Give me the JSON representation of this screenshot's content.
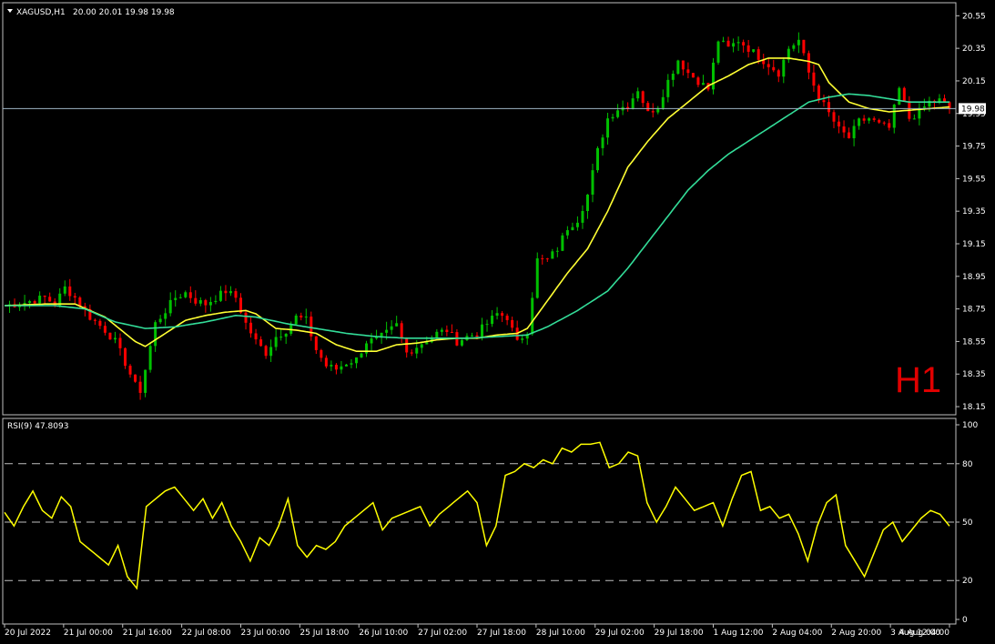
{
  "header": {
    "symbol_label": "XAGUSD,H1",
    "ohlc_label": "20.00 20.01 19.98 19.98"
  },
  "timeframe_label": "H1",
  "rsi_header": {
    "label": "RSI(9) 47.8093"
  },
  "current_price_label": "19.98",
  "colors": {
    "background": "#000000",
    "bull_candle": "#00c000",
    "bear_candle": "#ff0000",
    "ma_fast": "#ffff33",
    "ma_slow": "#33dd99",
    "rsi_line": "#ffff00",
    "grid_text": "#ffffff",
    "timeframe": "#e00000"
  },
  "chart_data": [
    {
      "type": "candlestick",
      "title": "XAGUSD,H1",
      "ylim": [
        18.1,
        20.63
      ],
      "y_ticks": [
        "20.55",
        "20.35",
        "20.15",
        "19.95",
        "19.75",
        "19.55",
        "19.35",
        "19.15",
        "18.95",
        "18.75",
        "18.55",
        "18.35",
        "18.15"
      ],
      "y_tick_values": [
        20.55,
        20.35,
        20.15,
        19.95,
        19.75,
        19.55,
        19.35,
        19.15,
        18.95,
        18.75,
        18.55,
        18.35,
        18.15
      ],
      "x_ticks": [
        "20 Jul 2022",
        "21 Jul 00:00",
        "21 Jul 16:00",
        "22 Jul 08:00",
        "23 Jul 00:00",
        "25 Jul 18:00",
        "26 Jul 10:00",
        "27 Jul 02:00",
        "27 Jul 18:00",
        "28 Jul 10:00",
        "29 Jul 02:00",
        "29 Jul 18:00",
        "1 Aug 12:00",
        "2 Aug 04:00",
        "2 Aug 20:00",
        "3 Aug 12:00",
        "4 Aug 04:00"
      ],
      "current_price": 19.98,
      "close_path": [
        [
          0,
          18.77
        ],
        [
          4,
          18.79
        ],
        [
          8,
          18.82
        ],
        [
          10,
          18.78
        ],
        [
          12,
          18.88
        ],
        [
          14,
          18.82
        ],
        [
          17,
          18.7
        ],
        [
          20,
          18.62
        ],
        [
          22,
          18.55
        ],
        [
          24,
          18.42
        ],
        [
          26,
          18.28
        ],
        [
          27,
          18.25
        ],
        [
          28,
          18.38
        ],
        [
          30,
          18.66
        ],
        [
          32,
          18.74
        ],
        [
          34,
          18.82
        ],
        [
          36,
          18.85
        ],
        [
          38,
          18.8
        ],
        [
          40,
          18.78
        ],
        [
          42,
          18.82
        ],
        [
          44,
          18.86
        ],
        [
          46,
          18.82
        ],
        [
          48,
          18.66
        ],
        [
          50,
          18.55
        ],
        [
          52,
          18.48
        ],
        [
          54,
          18.58
        ],
        [
          56,
          18.62
        ],
        [
          58,
          18.7
        ],
        [
          60,
          18.68
        ],
        [
          62,
          18.5
        ],
        [
          64,
          18.4
        ],
        [
          66,
          18.38
        ],
        [
          68,
          18.42
        ],
        [
          70,
          18.44
        ],
        [
          72,
          18.55
        ],
        [
          74,
          18.56
        ],
        [
          76,
          18.6
        ],
        [
          78,
          18.65
        ],
        [
          80,
          18.48
        ],
        [
          82,
          18.52
        ],
        [
          84,
          18.56
        ],
        [
          86,
          18.6
        ],
        [
          88,
          18.62
        ],
        [
          90,
          18.55
        ],
        [
          92,
          18.58
        ],
        [
          94,
          18.6
        ],
        [
          96,
          18.66
        ],
        [
          98,
          18.72
        ],
        [
          100,
          18.7
        ],
        [
          102,
          18.54
        ],
        [
          104,
          18.62
        ],
        [
          106,
          19.05
        ],
        [
          108,
          19.05
        ],
        [
          110,
          19.12
        ],
        [
          112,
          19.25
        ],
        [
          114,
          19.3
        ],
        [
          116,
          19.45
        ],
        [
          118,
          19.72
        ],
        [
          120,
          19.92
        ],
        [
          122,
          19.98
        ],
        [
          124,
          20.0
        ],
        [
          126,
          20.1
        ],
        [
          128,
          19.95
        ],
        [
          130,
          20.0
        ],
        [
          132,
          20.15
        ],
        [
          134,
          20.28
        ],
        [
          136,
          20.2
        ],
        [
          138,
          20.15
        ],
        [
          140,
          20.1
        ],
        [
          142,
          20.4
        ],
        [
          144,
          20.35
        ],
        [
          146,
          20.4
        ],
        [
          148,
          20.35
        ],
        [
          150,
          20.3
        ],
        [
          152,
          20.25
        ],
        [
          154,
          20.2
        ],
        [
          156,
          20.35
        ],
        [
          158,
          20.4
        ],
        [
          160,
          20.2
        ],
        [
          162,
          20.05
        ],
        [
          164,
          19.95
        ],
        [
          166,
          19.85
        ],
        [
          168,
          19.8
        ],
        [
          170,
          19.9
        ],
        [
          172,
          19.92
        ],
        [
          174,
          19.88
        ],
        [
          176,
          19.86
        ],
        [
          178,
          20.1
        ],
        [
          180,
          19.92
        ],
        [
          182,
          19.96
        ],
        [
          184,
          20.02
        ],
        [
          186,
          20.03
        ],
        [
          188,
          19.98
        ]
      ],
      "series": [
        {
          "name": "",
          "role": "ma_fast",
          "values": [
            [
              0,
              18.77
            ],
            [
              8,
              18.78
            ],
            [
              14,
              18.78
            ],
            [
              20,
              18.7
            ],
            [
              26,
              18.55
            ],
            [
              28,
              18.52
            ],
            [
              32,
              18.6
            ],
            [
              36,
              18.68
            ],
            [
              40,
              18.71
            ],
            [
              44,
              18.73
            ],
            [
              48,
              18.74
            ],
            [
              50,
              18.72
            ],
            [
              54,
              18.63
            ],
            [
              58,
              18.62
            ],
            [
              62,
              18.6
            ],
            [
              66,
              18.53
            ],
            [
              70,
              18.49
            ],
            [
              74,
              18.49
            ],
            [
              78,
              18.53
            ],
            [
              82,
              18.54
            ],
            [
              86,
              18.56
            ],
            [
              90,
              18.57
            ],
            [
              94,
              18.57
            ],
            [
              98,
              18.59
            ],
            [
              102,
              18.6
            ],
            [
              104,
              18.63
            ],
            [
              108,
              18.8
            ],
            [
              112,
              18.97
            ],
            [
              116,
              19.12
            ],
            [
              120,
              19.35
            ],
            [
              124,
              19.62
            ],
            [
              128,
              19.78
            ],
            [
              132,
              19.92
            ],
            [
              136,
              20.02
            ],
            [
              140,
              20.12
            ],
            [
              144,
              20.18
            ],
            [
              148,
              20.25
            ],
            [
              152,
              20.29
            ],
            [
              156,
              20.29
            ],
            [
              160,
              20.27
            ],
            [
              162,
              20.25
            ],
            [
              164,
              20.14
            ],
            [
              168,
              20.02
            ],
            [
              172,
              19.98
            ],
            [
              176,
              19.96
            ],
            [
              180,
              19.97
            ],
            [
              184,
              19.98
            ],
            [
              188,
              19.99
            ]
          ]
        },
        {
          "name": "",
          "role": "ma_slow",
          "values": [
            [
              0,
              18.77
            ],
            [
              10,
              18.77
            ],
            [
              16,
              18.75
            ],
            [
              22,
              18.67
            ],
            [
              28,
              18.63
            ],
            [
              34,
              18.64
            ],
            [
              40,
              18.67
            ],
            [
              46,
              18.71
            ],
            [
              50,
              18.7
            ],
            [
              56,
              18.66
            ],
            [
              62,
              18.63
            ],
            [
              68,
              18.6
            ],
            [
              74,
              18.58
            ],
            [
              80,
              18.57
            ],
            [
              86,
              18.57
            ],
            [
              92,
              18.57
            ],
            [
              98,
              18.58
            ],
            [
              104,
              18.59
            ],
            [
              108,
              18.64
            ],
            [
              114,
              18.74
            ],
            [
              120,
              18.86
            ],
            [
              124,
              19.0
            ],
            [
              128,
              19.16
            ],
            [
              132,
              19.32
            ],
            [
              136,
              19.48
            ],
            [
              140,
              19.6
            ],
            [
              144,
              19.7
            ],
            [
              148,
              19.78
            ],
            [
              152,
              19.86
            ],
            [
              156,
              19.94
            ],
            [
              160,
              20.02
            ],
            [
              164,
              20.05
            ],
            [
              168,
              20.07
            ],
            [
              172,
              20.06
            ],
            [
              176,
              20.04
            ],
            [
              180,
              20.02
            ],
            [
              184,
              20.02
            ],
            [
              188,
              20.02
            ]
          ]
        }
      ]
    },
    {
      "type": "line",
      "title": "RSI(9) 47.8093",
      "ylim": [
        0,
        100
      ],
      "y_ticks": [
        "100",
        "80",
        "50",
        "20",
        "0"
      ],
      "y_tick_values": [
        100,
        80,
        50,
        20,
        0
      ],
      "levels": [
        80,
        50,
        20
      ],
      "series": [
        {
          "name": "",
          "values": [
            [
              0,
              55
            ],
            [
              2,
              48
            ],
            [
              4,
              58
            ],
            [
              6,
              66
            ],
            [
              8,
              56
            ],
            [
              10,
              52
            ],
            [
              12,
              63
            ],
            [
              14,
              58
            ],
            [
              16,
              40
            ],
            [
              18,
              36
            ],
            [
              20,
              32
            ],
            [
              22,
              28
            ],
            [
              24,
              38
            ],
            [
              26,
              22
            ],
            [
              28,
              16
            ],
            [
              30,
              58
            ],
            [
              32,
              62
            ],
            [
              34,
              66
            ],
            [
              36,
              68
            ],
            [
              38,
              62
            ],
            [
              40,
              56
            ],
            [
              42,
              62
            ],
            [
              44,
              52
            ],
            [
              46,
              60
            ],
            [
              48,
              48
            ],
            [
              50,
              40
            ],
            [
              52,
              30
            ],
            [
              54,
              42
            ],
            [
              56,
              38
            ],
            [
              58,
              48
            ],
            [
              60,
              62
            ],
            [
              62,
              38
            ],
            [
              64,
              32
            ],
            [
              66,
              38
            ],
            [
              68,
              36
            ],
            [
              70,
              40
            ],
            [
              72,
              48
            ],
            [
              74,
              52
            ],
            [
              76,
              56
            ],
            [
              78,
              60
            ],
            [
              80,
              46
            ],
            [
              82,
              52
            ],
            [
              84,
              54
            ],
            [
              86,
              56
            ],
            [
              88,
              58
            ],
            [
              90,
              48
            ],
            [
              92,
              54
            ],
            [
              94,
              58
            ],
            [
              96,
              62
            ],
            [
              98,
              66
            ],
            [
              100,
              60
            ],
            [
              102,
              38
            ],
            [
              104,
              48
            ],
            [
              106,
              74
            ],
            [
              108,
              76
            ],
            [
              110,
              80
            ],
            [
              112,
              78
            ],
            [
              114,
              82
            ],
            [
              116,
              80
            ],
            [
              118,
              88
            ],
            [
              120,
              86
            ],
            [
              122,
              90
            ],
            [
              124,
              90
            ],
            [
              126,
              91
            ],
            [
              128,
              78
            ],
            [
              130,
              80
            ],
            [
              132,
              86
            ],
            [
              134,
              84
            ],
            [
              136,
              60
            ],
            [
              138,
              50
            ],
            [
              140,
              58
            ],
            [
              142,
              68
            ],
            [
              144,
              62
            ],
            [
              146,
              56
            ],
            [
              148,
              58
            ],
            [
              150,
              60
            ],
            [
              152,
              48
            ],
            [
              154,
              62
            ],
            [
              156,
              74
            ],
            [
              158,
              76
            ],
            [
              160,
              56
            ],
            [
              162,
              58
            ],
            [
              164,
              52
            ],
            [
              166,
              54
            ],
            [
              168,
              44
            ],
            [
              170,
              30
            ],
            [
              172,
              48
            ],
            [
              174,
              60
            ],
            [
              176,
              64
            ],
            [
              178,
              38
            ],
            [
              180,
              30
            ],
            [
              182,
              22
            ],
            [
              184,
              34
            ],
            [
              186,
              46
            ],
            [
              188,
              50
            ],
            [
              190,
              40
            ],
            [
              192,
              46
            ],
            [
              194,
              52
            ],
            [
              196,
              56
            ],
            [
              198,
              54
            ],
            [
              200,
              48
            ]
          ]
        }
      ]
    }
  ]
}
